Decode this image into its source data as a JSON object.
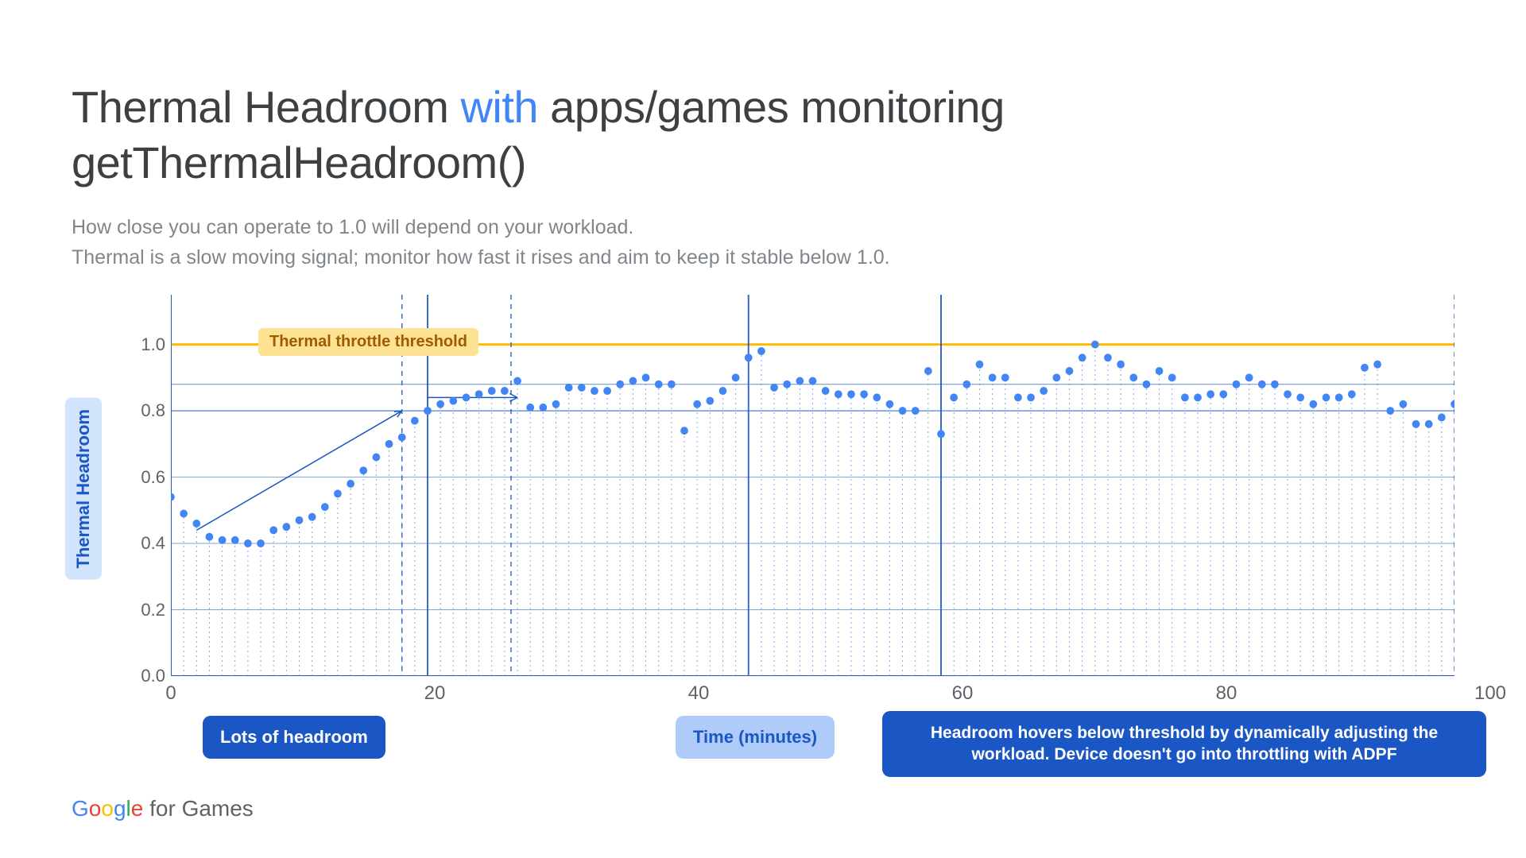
{
  "title": {
    "pre": "Thermal Headroom ",
    "accent": "with",
    "post": " apps/games monitoring getThermalHeadroom()"
  },
  "subtitle": "How close you can operate to 1.0 will depend on your workload.\nThermal is a slow moving signal; monitor how fast it rises and aim to keep it stable below 1.0.",
  "ylabel": "Thermal Headroom",
  "xlabel": "Time (minutes)",
  "threshold_label": "Thermal throttle threshold",
  "badges": {
    "left": "Lots of headroom",
    "right": "Headroom hovers below threshold by dynamically adjusting the workload. Device doesn't go into throttling with ADPF"
  },
  "footer": {
    "brand": "Google",
    "suffix": " for Games"
  },
  "chart_data": {
    "type": "scatter",
    "xlabel": "Time (minutes)",
    "ylabel": "Thermal Headroom",
    "xlim": [
      0,
      100
    ],
    "ylim": [
      0.0,
      1.15
    ],
    "xticks": [
      0,
      20,
      40,
      60,
      80,
      100
    ],
    "yticks": [
      0.0,
      0.2,
      0.4,
      0.6,
      0.8,
      1.0
    ],
    "threshold": 1.0,
    "reference_band": [
      0.8,
      0.88
    ],
    "region_dividers_x": [
      0,
      18,
      20,
      26.5,
      45,
      60,
      100
    ],
    "x": [
      0,
      1,
      2,
      3,
      4,
      5,
      6,
      7,
      8,
      9,
      10,
      11,
      12,
      13,
      14,
      15,
      16,
      17,
      18,
      19,
      20,
      21,
      22,
      23,
      24,
      25,
      26,
      27,
      28,
      29,
      30,
      31,
      32,
      33,
      34,
      35,
      36,
      37,
      38,
      39,
      40,
      41,
      42,
      43,
      44,
      45,
      46,
      47,
      48,
      49,
      50,
      51,
      52,
      53,
      54,
      55,
      56,
      57,
      58,
      59,
      60,
      61,
      62,
      63,
      64,
      65,
      66,
      67,
      68,
      69,
      70,
      71,
      72,
      73,
      74,
      75,
      76,
      77,
      78,
      79,
      80,
      81,
      82,
      83,
      84,
      85,
      86,
      87,
      88,
      89,
      90,
      91,
      92,
      93,
      94,
      95,
      96,
      97,
      98,
      99,
      100
    ],
    "y": [
      0.54,
      0.49,
      0.46,
      0.42,
      0.41,
      0.41,
      0.4,
      0.4,
      0.44,
      0.45,
      0.47,
      0.48,
      0.51,
      0.55,
      0.58,
      0.62,
      0.66,
      0.7,
      0.72,
      0.77,
      0.8,
      0.82,
      0.83,
      0.84,
      0.85,
      0.86,
      0.86,
      0.89,
      0.81,
      0.81,
      0.82,
      0.87,
      0.87,
      0.86,
      0.86,
      0.88,
      0.89,
      0.9,
      0.88,
      0.88,
      0.74,
      0.82,
      0.83,
      0.86,
      0.9,
      0.96,
      0.98,
      0.87,
      0.88,
      0.89,
      0.89,
      0.86,
      0.85,
      0.85,
      0.85,
      0.84,
      0.82,
      0.8,
      0.8,
      0.92,
      0.73,
      0.84,
      0.88,
      0.94,
      0.9,
      0.9,
      0.84,
      0.84,
      0.86,
      0.9,
      0.92,
      0.96,
      1.0,
      0.96,
      0.94,
      0.9,
      0.88,
      0.92,
      0.9,
      0.84,
      0.84,
      0.85,
      0.85,
      0.88,
      0.9,
      0.88,
      0.88,
      0.85,
      0.84,
      0.82,
      0.84,
      0.84,
      0.85,
      0.93,
      0.94,
      0.8,
      0.82,
      0.76,
      0.76,
      0.78,
      0.82
    ],
    "annotations": [
      {
        "text": "Lots of headroom",
        "x_range": [
          0,
          18
        ]
      },
      {
        "text": "Headroom hovers below threshold by dynamically adjusting the workload. Device doesn't go into throttling with ADPF",
        "x_range": [
          60,
          100
        ]
      }
    ]
  }
}
